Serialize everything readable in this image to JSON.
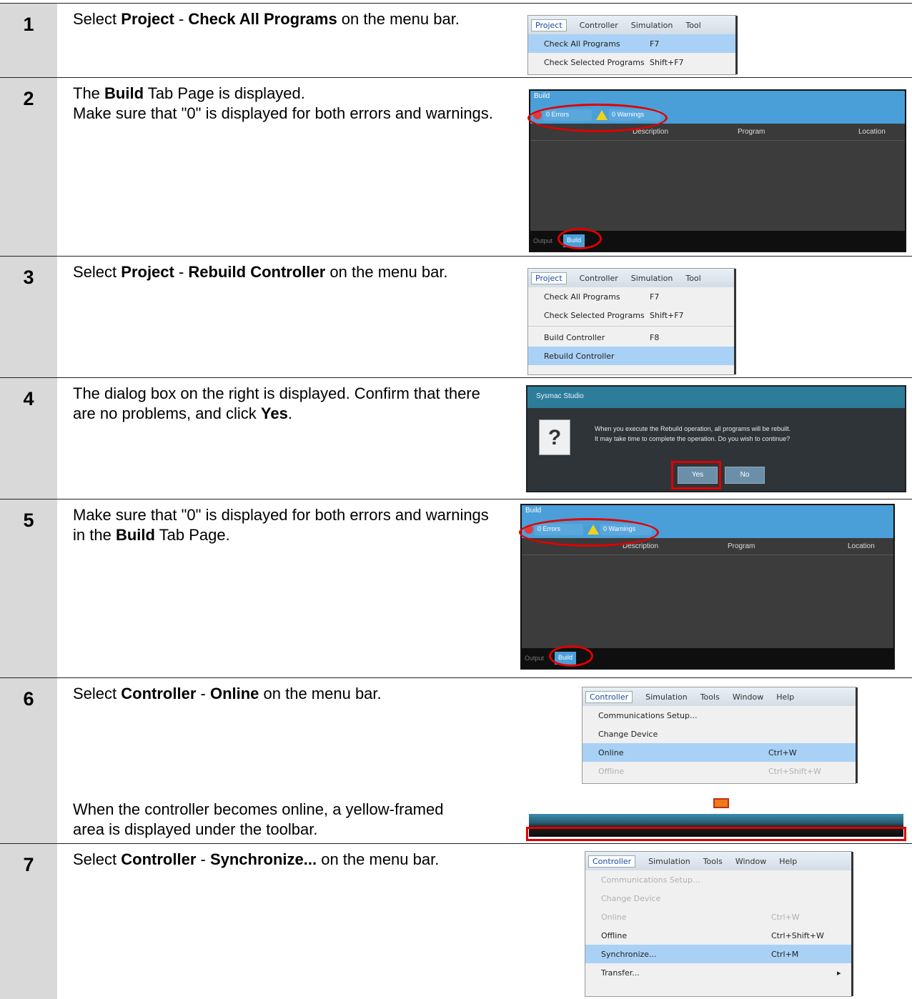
{
  "steps": [
    {
      "num": "1",
      "parts": [
        {
          "t": "Select "
        },
        {
          "t": "Project",
          "b": true
        },
        {
          "t": " - "
        },
        {
          "t": "Check All Programs",
          "b": true
        },
        {
          "t": " on the menu bar."
        }
      ],
      "screenshot": {
        "menubar": [
          "Project",
          "Controller",
          "Simulation",
          "Tool"
        ],
        "items": [
          {
            "label": "Check All Programs",
            "shortcut": "F7",
            "highlight": true
          },
          {
            "label": "Check Selected Programs",
            "shortcut": "Shift+F7"
          }
        ]
      }
    },
    {
      "num": "2",
      "parts": [
        {
          "t": "The "
        },
        {
          "t": "Build",
          "b": true
        },
        {
          "t": " Tab Page is displayed."
        },
        {
          "br": true
        },
        {
          "t": "Make sure that \"0\" is displayed for both errors and warnings."
        }
      ],
      "screenshot": {
        "title": "Build",
        "errors": "0 Errors",
        "warnings": "0 Warnings",
        "columns": [
          "Description",
          "Program",
          "Location"
        ],
        "footer_label": "Output",
        "tab": "Build"
      }
    },
    {
      "num": "3",
      "parts": [
        {
          "t": "Select "
        },
        {
          "t": "Project",
          "b": true
        },
        {
          "t": " - "
        },
        {
          "t": "Rebuild Controller",
          "b": true
        },
        {
          "t": " on the menu bar."
        }
      ],
      "screenshot": {
        "menubar": [
          "Project",
          "Controller",
          "Simulation",
          "Tool"
        ],
        "items": [
          {
            "label": "Check All Programs",
            "shortcut": "F7"
          },
          {
            "label": "Check Selected Programs",
            "shortcut": "Shift+F7"
          },
          {
            "sep": true
          },
          {
            "label": "Build Controller",
            "shortcut": "F8"
          },
          {
            "label": "Rebuild Controller",
            "shortcut": "",
            "highlight": true
          }
        ]
      }
    },
    {
      "num": "4",
      "parts": [
        {
          "t": "The dialog box on the right is displayed. Confirm that there are no problems, and click "
        },
        {
          "t": "Yes",
          "b": true
        },
        {
          "t": "."
        }
      ],
      "screenshot": {
        "title": "Sysmac Studio",
        "message1": "When you execute the Rebuild operation, all programs will be rebuilt.",
        "message2": "It may take time to complete the operation. Do you wish to continue?",
        "yes": "Yes",
        "no": "No"
      }
    },
    {
      "num": "5",
      "parts": [
        {
          "t": "Make sure that \"0\" is displayed for both errors and warnings in the "
        },
        {
          "t": "Build",
          "b": true
        },
        {
          "t": " Tab Page."
        }
      ],
      "screenshot": {
        "title": "Build",
        "errors": "0 Errors",
        "warnings": "0 Warnings",
        "columns": [
          "Description",
          "Program",
          "Location"
        ],
        "footer_label": "Output",
        "tab": "Build"
      }
    },
    {
      "num": "6",
      "parts": [
        {
          "t": "Select "
        },
        {
          "t": "Controller",
          "b": true
        },
        {
          "t": " - "
        },
        {
          "t": "Online",
          "b": true
        },
        {
          "t": " on the menu bar."
        }
      ],
      "parts2": [
        {
          "t": "When the controller becomes online, a yellow-framed area is displayed under the toolbar."
        }
      ],
      "screenshot": {
        "menubar": [
          "Controller",
          "Simulation",
          "Tools",
          "Window",
          "Help"
        ],
        "items": [
          {
            "label": "Communications Setup...",
            "shortcut": ""
          },
          {
            "label": "Change Device",
            "shortcut": ""
          },
          {
            "label": "Online",
            "shortcut": "Ctrl+W",
            "highlight": true
          },
          {
            "label": "Offline",
            "shortcut": "Ctrl+Shift+W",
            "disabled": true
          }
        ]
      }
    },
    {
      "num": "7",
      "parts": [
        {
          "t": "Select "
        },
        {
          "t": "Controller",
          "b": true
        },
        {
          "t": " - "
        },
        {
          "t": "Synchronize...",
          "b": true
        },
        {
          "t": " on the menu bar."
        }
      ],
      "screenshot": {
        "menubar": [
          "Controller",
          "Simulation",
          "Tools",
          "Window",
          "Help"
        ],
        "items": [
          {
            "label": "Communications Setup...",
            "shortcut": "",
            "disabled": true
          },
          {
            "label": "Change Device",
            "shortcut": "",
            "disabled": true
          },
          {
            "label": "Online",
            "shortcut": "Ctrl+W",
            "disabled": true
          },
          {
            "label": "Offline",
            "shortcut": "Ctrl+Shift+W"
          },
          {
            "label": "Synchronize...",
            "shortcut": "Ctrl+M",
            "highlight": true
          },
          {
            "label": "Transfer...",
            "shortcut": "",
            "submenu": true
          }
        ]
      }
    }
  ]
}
